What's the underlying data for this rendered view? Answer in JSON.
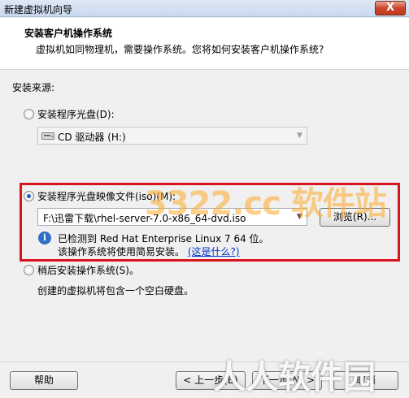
{
  "window": {
    "title": "新建虚拟机向导",
    "close_glyph": "X"
  },
  "header": {
    "title": "安装客户机操作系统",
    "subtitle": "虚拟机如同物理机，需要操作系统。您将如何安装客户机操作系统?"
  },
  "install_source": {
    "label": "安装来源:",
    "options": [
      {
        "label": "安装程序光盘(D):",
        "selected": false,
        "combo_value": "CD 驱动器 (H:)",
        "combo_enabled": false
      },
      {
        "label": "安装程序光盘映像文件(iso)(M):",
        "selected": true,
        "combo_value": "F:\\迅雷下载\\rhel-server-7.0-x86_64-dvd.iso",
        "browse_label": "浏览(R)..."
      },
      {
        "label": "稍后安装操作系统(S)。",
        "selected": false,
        "description": "创建的虚拟机将包含一个空白硬盘。"
      }
    ],
    "detection_line1": "已检测到 Red Hat Enterprise Linux 7 64 位。",
    "detection_line2": "该操作系统将使用简易安装。",
    "detection_link": "(这是什么?)"
  },
  "footer": {
    "help_label": "帮助",
    "back_label": "< 上一步(B)",
    "next_label": "下一步(N) >",
    "cancel_label": "取消"
  },
  "watermarks": {
    "site_logo": "3322.cc 软件站",
    "corner_logo": "人人软件园"
  },
  "icons": {
    "info": "info-icon",
    "cd": "cd-drive-icon",
    "combo_arrow": "chevron-down-icon"
  },
  "colors": {
    "highlight_box": "#d8141e",
    "link": "#0033cc"
  }
}
